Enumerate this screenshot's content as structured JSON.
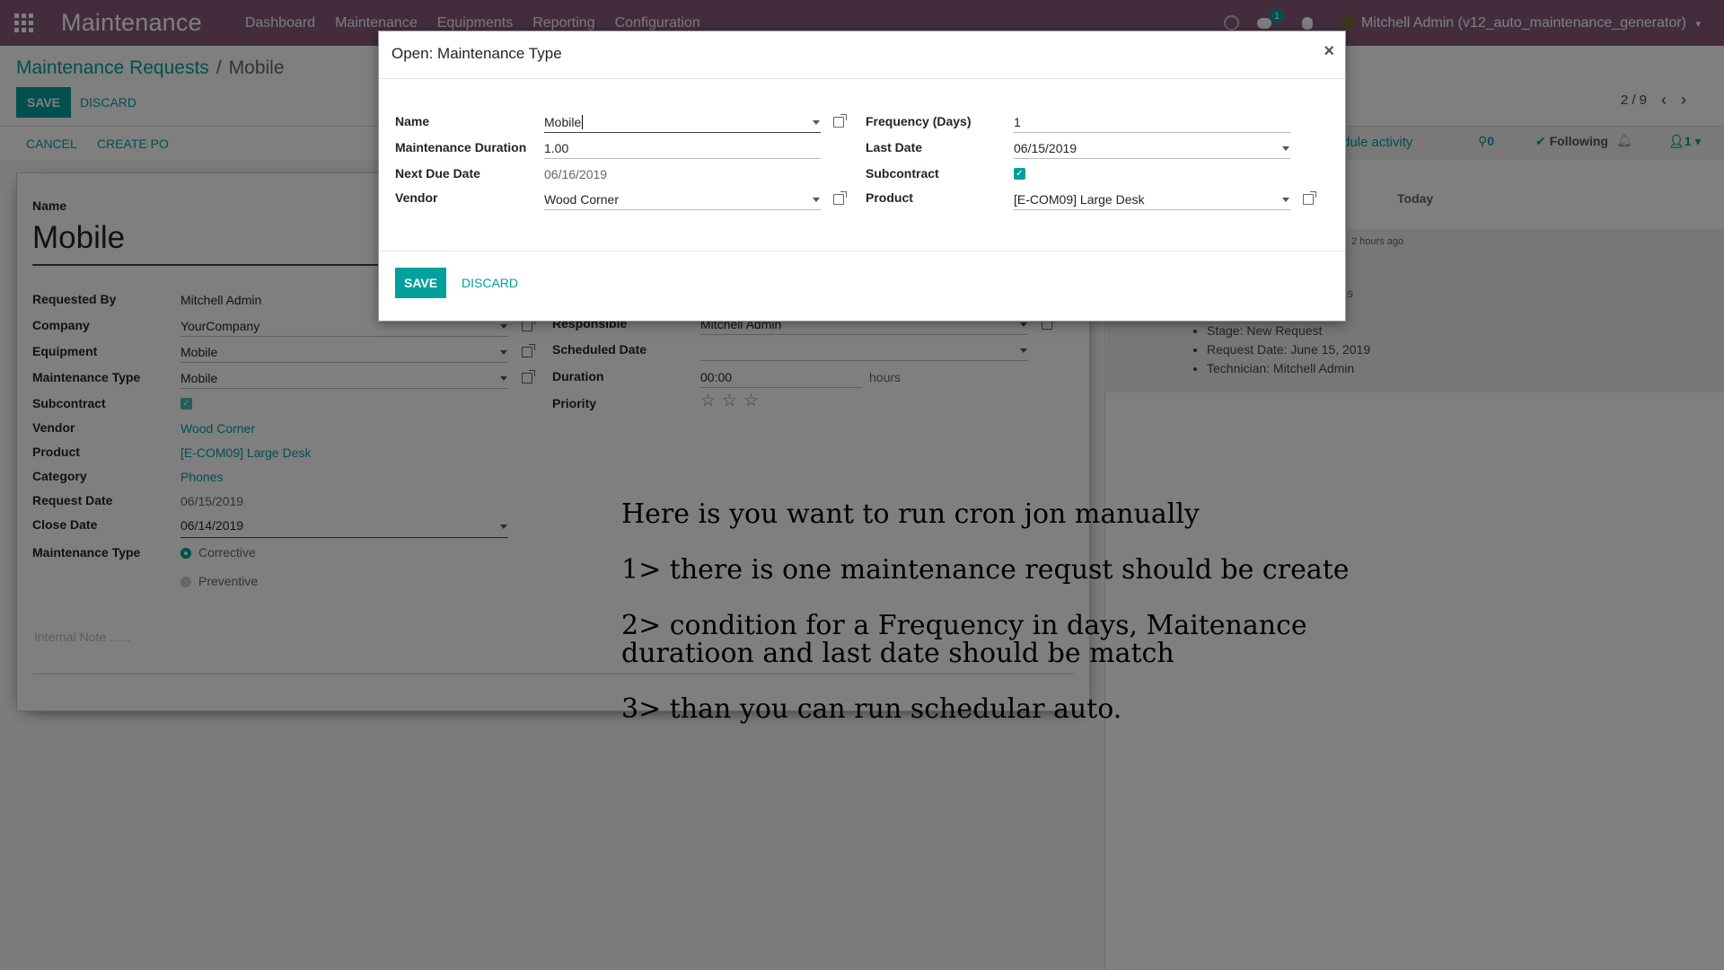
{
  "navbar": {
    "app_title": "Maintenance",
    "menu": [
      "Dashboard",
      "Maintenance",
      "Equipments",
      "Reporting",
      "Configuration"
    ],
    "chat_count": "1",
    "user": "Mitchell Admin (v12_auto_maintenance_generator)"
  },
  "control_panel": {
    "breadcrumb_parent": "Maintenance Requests",
    "breadcrumb_sep": "/",
    "breadcrumb_current": "Mobile",
    "save_label": "SAVE",
    "discard_label": "DISCARD",
    "pager": "2 / 9"
  },
  "statusbar": {
    "cancel_label": "CANCEL",
    "create_po_label": "CREATE PO"
  },
  "chatter": {
    "schedule_activity": "dule activity",
    "attachments": "0",
    "following": "Following",
    "followers": "1",
    "today": "Today",
    "time_ago": "2 hours ago",
    "partial_text": "s",
    "tracking": [
      "Stage: New Request",
      "Request Date: June 15, 2019",
      "Technician: Mitchell Admin"
    ]
  },
  "form": {
    "name_label": "Name",
    "name_value": "Mobile",
    "requested_by_label": "Requested By",
    "requested_by": "Mitchell Admin",
    "company_label": "Company",
    "company": "YourCompany",
    "equipment_label": "Equipment",
    "equipment": "Mobile",
    "maintenance_type_label": "Maintenance Type",
    "maintenance_type": "Mobile",
    "subcontract_label": "Subcontract",
    "vendor_label": "Vendor",
    "vendor": "Wood Corner",
    "product_label": "Product",
    "product": "[E-COM09] Large Desk",
    "category_label": "Category",
    "category": "Phones",
    "request_date_label": "Request Date",
    "request_date": "06/15/2019",
    "close_date_label": "Close Date",
    "close_date": "06/14/2019",
    "mtype_radio_label": "Maintenance Type",
    "radio_corrective": "Corrective",
    "radio_preventive": "Preventive",
    "internal_note_placeholder": "Internal Note ......",
    "responsible_label": "Responsible",
    "responsible": "Mitchell Admin",
    "scheduled_date_label": "Scheduled Date",
    "duration_label": "Duration",
    "duration": "00:00",
    "duration_unit": "hours",
    "priority_label": "Priority",
    "priority_stars": 0
  },
  "modal": {
    "title": "Open: Maintenance Type",
    "name_label": "Name",
    "name_value": "Mobile",
    "duration_label": "Maintenance Duration",
    "duration_value": "1.00",
    "next_due_label": "Next Due Date",
    "next_due_value": "06/16/2019",
    "vendor_label": "Vendor",
    "vendor_value": "Wood Corner",
    "frequency_label": "Frequency (Days)",
    "frequency_value": "1",
    "last_date_label": "Last Date",
    "last_date_value": "06/15/2019",
    "subcontract_label": "Subcontract",
    "subcontract_checked": true,
    "product_label": "Product",
    "product_value": "[E-COM09] Large Desk",
    "save_label": "SAVE",
    "discard_label": "DISCARD"
  },
  "annotation": {
    "line1": "Here is you want to run cron jon manually",
    "line2": "1> there is one maintenance requst should be create",
    "line3a": "2> condition for a Frequency in days, Maitenance",
    "line3b": "duratioon and last date should be match",
    "line4": "3> than you can run schedular auto."
  },
  "colors": {
    "brand": "#875a7b",
    "accent": "#00a09d"
  }
}
